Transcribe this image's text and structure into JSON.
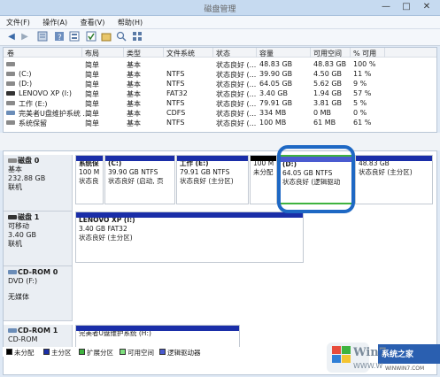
{
  "window": {
    "title": "磁盘管理",
    "min": "—",
    "max": "□",
    "close": "✕"
  },
  "menu": [
    "文件(F)",
    "操作(A)",
    "查看(V)",
    "帮助(H)"
  ],
  "toolbar": {
    "back": "◀",
    "forward": "▶"
  },
  "volumes": {
    "headers": [
      "卷",
      "布局",
      "类型",
      "文件系统",
      "状态",
      "容量",
      "可用空间",
      "% 可用"
    ],
    "rows": [
      [
        "",
        "简单",
        "基本",
        "",
        "状态良好 (...",
        "48.83 GB",
        "48.83 GB",
        "100 %"
      ],
      [
        "(C:)",
        "简单",
        "基本",
        "NTFS",
        "状态良好 (...",
        "39.90 GB",
        "4.50 GB",
        "11 %"
      ],
      [
        "(D:)",
        "简单",
        "基本",
        "NTFS",
        "状态良好 (...",
        "64.05 GB",
        "5.62 GB",
        "9 %"
      ],
      [
        "LENOVO XP (I:)",
        "简单",
        "基本",
        "FAT32",
        "状态良好 (...",
        "3.40 GB",
        "1.94 GB",
        "57 %"
      ],
      [
        "工作 (E:)",
        "简单",
        "基本",
        "NTFS",
        "状态良好 (...",
        "79.91 GB",
        "3.81 GB",
        "5 %"
      ],
      [
        "完美者U盘维护系统 ...",
        "简单",
        "基本",
        "CDFS",
        "状态良好 (...",
        "334 MB",
        "0 MB",
        "0 %"
      ],
      [
        "系统保留",
        "简单",
        "基本",
        "NTFS",
        "状态良好 (...",
        "100 MB",
        "61 MB",
        "61 %"
      ]
    ]
  },
  "disks": [
    {
      "name": "磁盘 0",
      "type": "基本",
      "size": "232.88 GB",
      "state": "联机",
      "parts": [
        {
          "l1": "系统保",
          "l2": "100 M",
          "l3": "状态良"
        },
        {
          "l1": "(C:)",
          "l2": "39.90 GB NTFS",
          "l3": "状态良好 (启动, 页"
        },
        {
          "l1": "工作  (E:)",
          "l2": "79.91 GB NTFS",
          "l3": "状态良好 (主分区)"
        },
        {
          "l1": "",
          "l2": "100 M",
          "l3": "未分配"
        },
        {
          "l1": "(D:)",
          "l2": "64.05 GB NTFS",
          "l3": "状态良好 (逻辑驱动"
        },
        {
          "l1": "",
          "l2": "48.83 GB",
          "l3": "状态良好 (主分区)"
        }
      ]
    },
    {
      "name": "磁盘 1",
      "type": "可移动",
      "size": "3.40 GB",
      "state": "联机",
      "parts": [
        {
          "l1": "LENOVO XP  (I:)",
          "l2": "3.40 GB FAT32",
          "l3": "状态良好 (主分区)"
        }
      ]
    },
    {
      "name": "CD-ROM 0",
      "type": "DVD (F:)",
      "size": "",
      "state": "无媒体",
      "parts": []
    },
    {
      "name": "CD-ROM 1",
      "type": "CD-ROM",
      "size": "",
      "state": "",
      "parts": [
        {
          "l1": "完美者U盘维护系统  (H:)",
          "l2": "",
          "l3": ""
        }
      ]
    }
  ],
  "legend": [
    "未分配",
    "主分区",
    "扩展分区",
    "可用空间",
    "逻辑驱动器"
  ],
  "colors": {
    "unalloc": "#000000",
    "primary": "#1a2ea8",
    "extended": "#3fb33f",
    "free": "#7fe07f",
    "logical": "#4a5bd0"
  },
  "watermark": {
    "text1": "Win7",
    "text2": "系统之家",
    "text3": "WWW.W",
    "text4": "WINWIN7.COM"
  }
}
